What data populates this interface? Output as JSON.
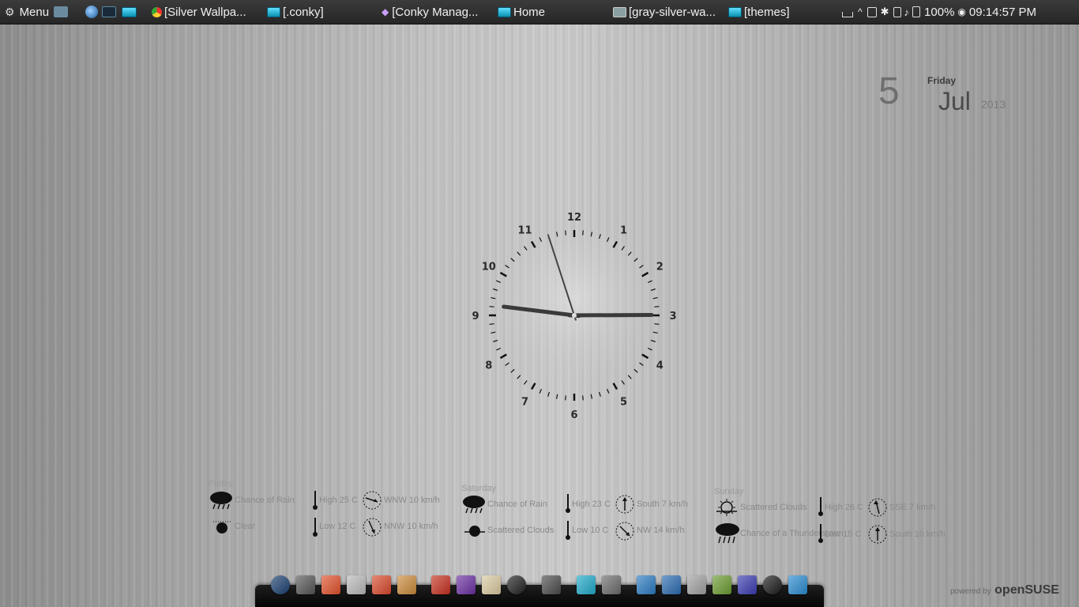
{
  "panel": {
    "menu_label": "Menu",
    "windows": [
      {
        "label": "[Silver Wallpa..."
      },
      {
        "label": "[.conky]"
      },
      {
        "label": "[Conky Manag..."
      },
      {
        "label": "Home"
      },
      {
        "label": "[gray-silver-wa..."
      },
      {
        "label": "[themes]"
      }
    ],
    "battery": "100%",
    "time": "09:14:57 PM"
  },
  "date": {
    "day": "5",
    "weekday": "Friday",
    "month": "Jul",
    "year": "2013"
  },
  "clock": {
    "numbers": [
      "12",
      "1",
      "2",
      "3",
      "4",
      "5",
      "6",
      "7",
      "8",
      "9",
      "10",
      "11"
    ],
    "hour": 9,
    "minute": 14,
    "second": 57
  },
  "weather": [
    {
      "day": "Friday",
      "day_condition": "Chance of Rain",
      "night_condition": "Clear",
      "high": "High 25 C",
      "low": "Low 12 C",
      "wind_day": "WNW 10 km/h",
      "wind_night": "NNW 10 km/h"
    },
    {
      "day": "Saturday",
      "day_condition": "Chance of Rain",
      "night_condition": "Scattered Clouds",
      "high": "High 23 C",
      "low": "Low 10 C",
      "wind_day": "South 7 km/h",
      "wind_night": "NW 14 km/h"
    },
    {
      "day": "Sunday",
      "day_condition": "Scattered Clouds",
      "night_condition": "Chance of a Thunderstorm",
      "high": "High 26 C",
      "low": "Low 15 C",
      "wind_day": "SSE 7 km/h",
      "wind_night": "South 10 km/h"
    }
  ],
  "powered": {
    "small": "powered by",
    "brand": "openSUSE"
  },
  "dock_icons": [
    {
      "name": "clock-app-icon",
      "color": "#1a3e6e"
    },
    {
      "name": "mail-icon",
      "color": "#555555"
    },
    {
      "name": "apps-icon",
      "color": "#e0502a"
    },
    {
      "name": "mask-icon",
      "color": "#b9b9b9"
    },
    {
      "name": "browser-icon",
      "color": "#d8492b"
    },
    {
      "name": "tools-icon",
      "color": "#c98a3a"
    },
    {
      "name": "media-icon",
      "color": "#c43020"
    },
    {
      "name": "purple-app-icon",
      "color": "#6a2fa0"
    },
    {
      "name": "trash-app-icon",
      "color": "#d9c9a0"
    },
    {
      "name": "wordpress-icon",
      "color": "#202020"
    },
    {
      "name": "at-mail-icon",
      "color": "#4a4a4a"
    },
    {
      "name": "files-icon",
      "color": "#1fa8c8"
    },
    {
      "name": "terminal-icon",
      "color": "#6a6a6a"
    },
    {
      "name": "home-folder-icon",
      "color": "#2a7ac0"
    },
    {
      "name": "mail-client-icon",
      "color": "#2a6ab0"
    },
    {
      "name": "search-icon",
      "color": "#a0a0a0"
    },
    {
      "name": "photos-icon",
      "color": "#6a9a30"
    },
    {
      "name": "graphics-icon",
      "color": "#3a3ab0"
    },
    {
      "name": "power-icon",
      "color": "#1a1a1a"
    },
    {
      "name": "html5-icon",
      "color": "#2a8ad0"
    }
  ]
}
